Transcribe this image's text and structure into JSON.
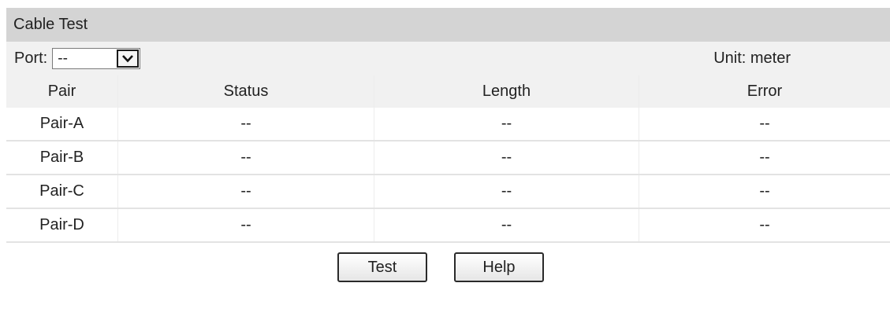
{
  "panel": {
    "title": "Cable Test"
  },
  "port": {
    "label": "Port:",
    "selected": "--"
  },
  "unit": "Unit: meter",
  "table": {
    "headers": [
      "Pair",
      "Status",
      "Length",
      "Error"
    ],
    "rows": [
      {
        "pair": "Pair-A",
        "status": "--",
        "length": "--",
        "error": "--"
      },
      {
        "pair": "Pair-B",
        "status": "--",
        "length": "--",
        "error": "--"
      },
      {
        "pair": "Pair-C",
        "status": "--",
        "length": "--",
        "error": "--"
      },
      {
        "pair": "Pair-D",
        "status": "--",
        "length": "--",
        "error": "--"
      }
    ]
  },
  "buttons": {
    "test": "Test",
    "help": "Help"
  },
  "icons": {
    "select_arrow": "chevron-down-icon"
  },
  "colors": {
    "title_bar": "#d4d4d4",
    "row_band": "#f1f1f1"
  }
}
